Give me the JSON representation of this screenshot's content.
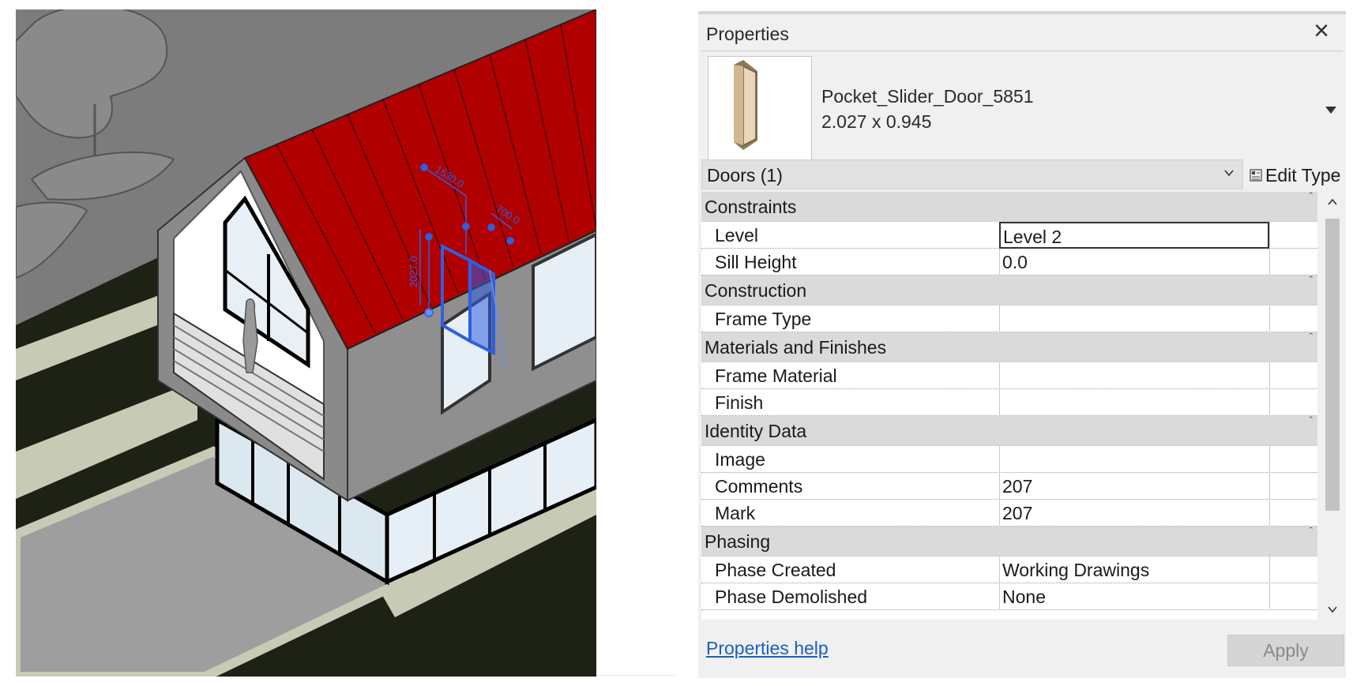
{
  "properties_panel": {
    "title": "Properties",
    "close_icon": "close-icon",
    "type_selector": {
      "name": "Pocket_Slider_Door_5851",
      "size": "2.027 x 0.945",
      "thumbnail_icon": "door-thumbnail-icon",
      "dropdown_icon": "triangle-down-icon"
    },
    "filter": {
      "label": "Doors (1)",
      "chevron_icon": "chevron-down-icon"
    },
    "edit_type": {
      "label": "Edit Type",
      "icon": "edit-type-icon"
    },
    "groups": [
      {
        "label": "Constraints",
        "rows": [
          {
            "label": "Level",
            "value": "Level 2"
          },
          {
            "label": "Sill Height",
            "value": "0.0"
          }
        ]
      },
      {
        "label": "Construction",
        "rows": [
          {
            "label": "Frame Type",
            "value": ""
          }
        ]
      },
      {
        "label": "Materials and Finishes",
        "rows": [
          {
            "label": "Frame Material",
            "value": ""
          },
          {
            "label": "Finish",
            "value": ""
          }
        ]
      },
      {
        "label": "Identity Data",
        "rows": [
          {
            "label": "Image",
            "value": ""
          },
          {
            "label": "Comments",
            "value": "207"
          },
          {
            "label": "Mark",
            "value": "207"
          }
        ]
      },
      {
        "label": "Phasing",
        "rows": [
          {
            "label": "Phase Created",
            "value": "Working Drawings"
          },
          {
            "label": "Phase Demolished",
            "value": "None"
          }
        ]
      }
    ],
    "collapse_icon": "caret-up-icon",
    "help_link": "Properties help",
    "apply_label": "Apply"
  },
  "viewport": {
    "dimensions": {
      "top": "1530.0",
      "right": "700.0",
      "left": "2027.0"
    },
    "colors": {
      "roof": "#b00000",
      "selection": "#2f5fe0",
      "wall": "#8a8a8a",
      "ground": "#1d2214"
    }
  }
}
